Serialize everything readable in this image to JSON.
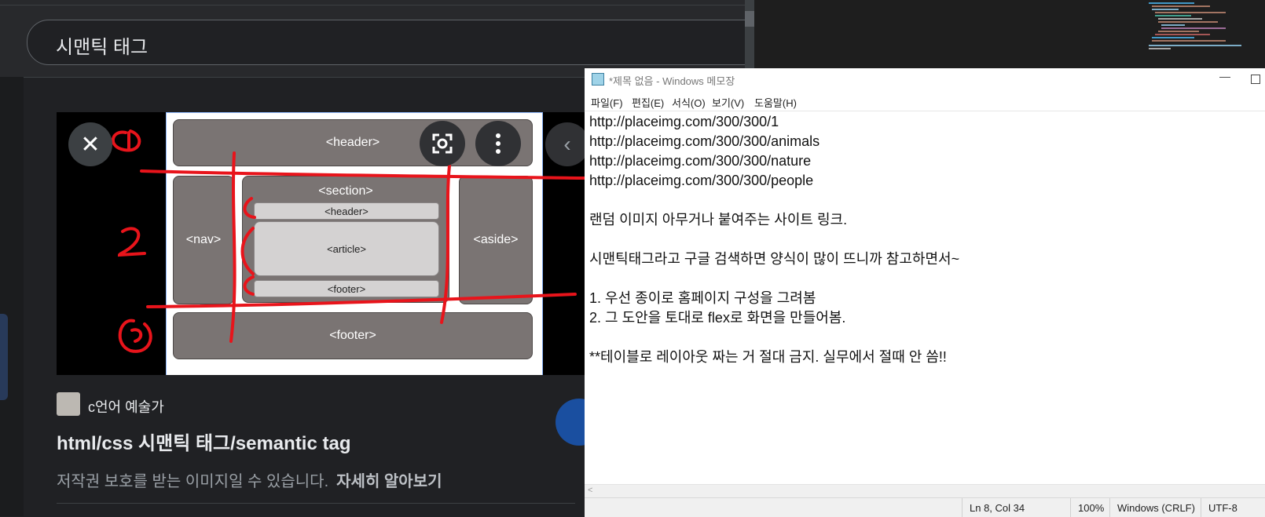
{
  "google": {
    "search_query": "시맨틱 태그",
    "diagram": {
      "header": "<header>",
      "nav": "<nav>",
      "section": "<section>",
      "section_header": "<header>",
      "article": "<article>",
      "section_footer": "<footer>",
      "aside": "<aside>",
      "footer": "<footer>"
    },
    "close_label": "✕",
    "next_label": "‹",
    "site_name": "c언어 예술가",
    "result_title": "html/css 시맨틱 태그/semantic tag",
    "copyright_text": "저작권 보호를 받는 이미지일 수 있습니다.",
    "learn_more": "자세히 알아보기"
  },
  "notepad": {
    "title": "*제목 없음 - Windows 메모장",
    "minimize": "—",
    "menu": [
      "파일(F)",
      "편집(E)",
      "서식(O)",
      "보기(V)",
      "도움말(H)"
    ],
    "lines": [
      "http://placeimg.com/300/300/1",
      "http://placeimg.com/300/300/animals",
      "http://placeimg.com/300/300/nature",
      "http://placeimg.com/300/300/people",
      "",
      "랜덤 이미지 아무거나 붙여주는 사이트 링크.",
      "",
      "시맨틱태그라고 구글 검색하면 양식이 많이 뜨니까 참고하면서~",
      "",
      "1. 우선 종이로 홈페이지 구성을 그려봄",
      "2. 그 도안을 토대로 flex로 화면을 만들어봄.",
      "",
      "**테이블로 레이아웃 짜는 거 절대 금지. 실무에서 절때 안 씀!!"
    ],
    "status": {
      "position": "Ln 8, Col 34",
      "zoom": "100%",
      "line_ending": "Windows (CRLF)",
      "encoding": "UTF-8"
    }
  },
  "colors": {
    "google_bg": "#202124",
    "annotation_red": "#e8141b",
    "block_gray": "#7a7473"
  },
  "icons": [
    "close-icon",
    "lens-icon",
    "more-vert-icon",
    "chevron-left-icon",
    "notepad-icon",
    "minimize-icon",
    "maximize-icon"
  ]
}
